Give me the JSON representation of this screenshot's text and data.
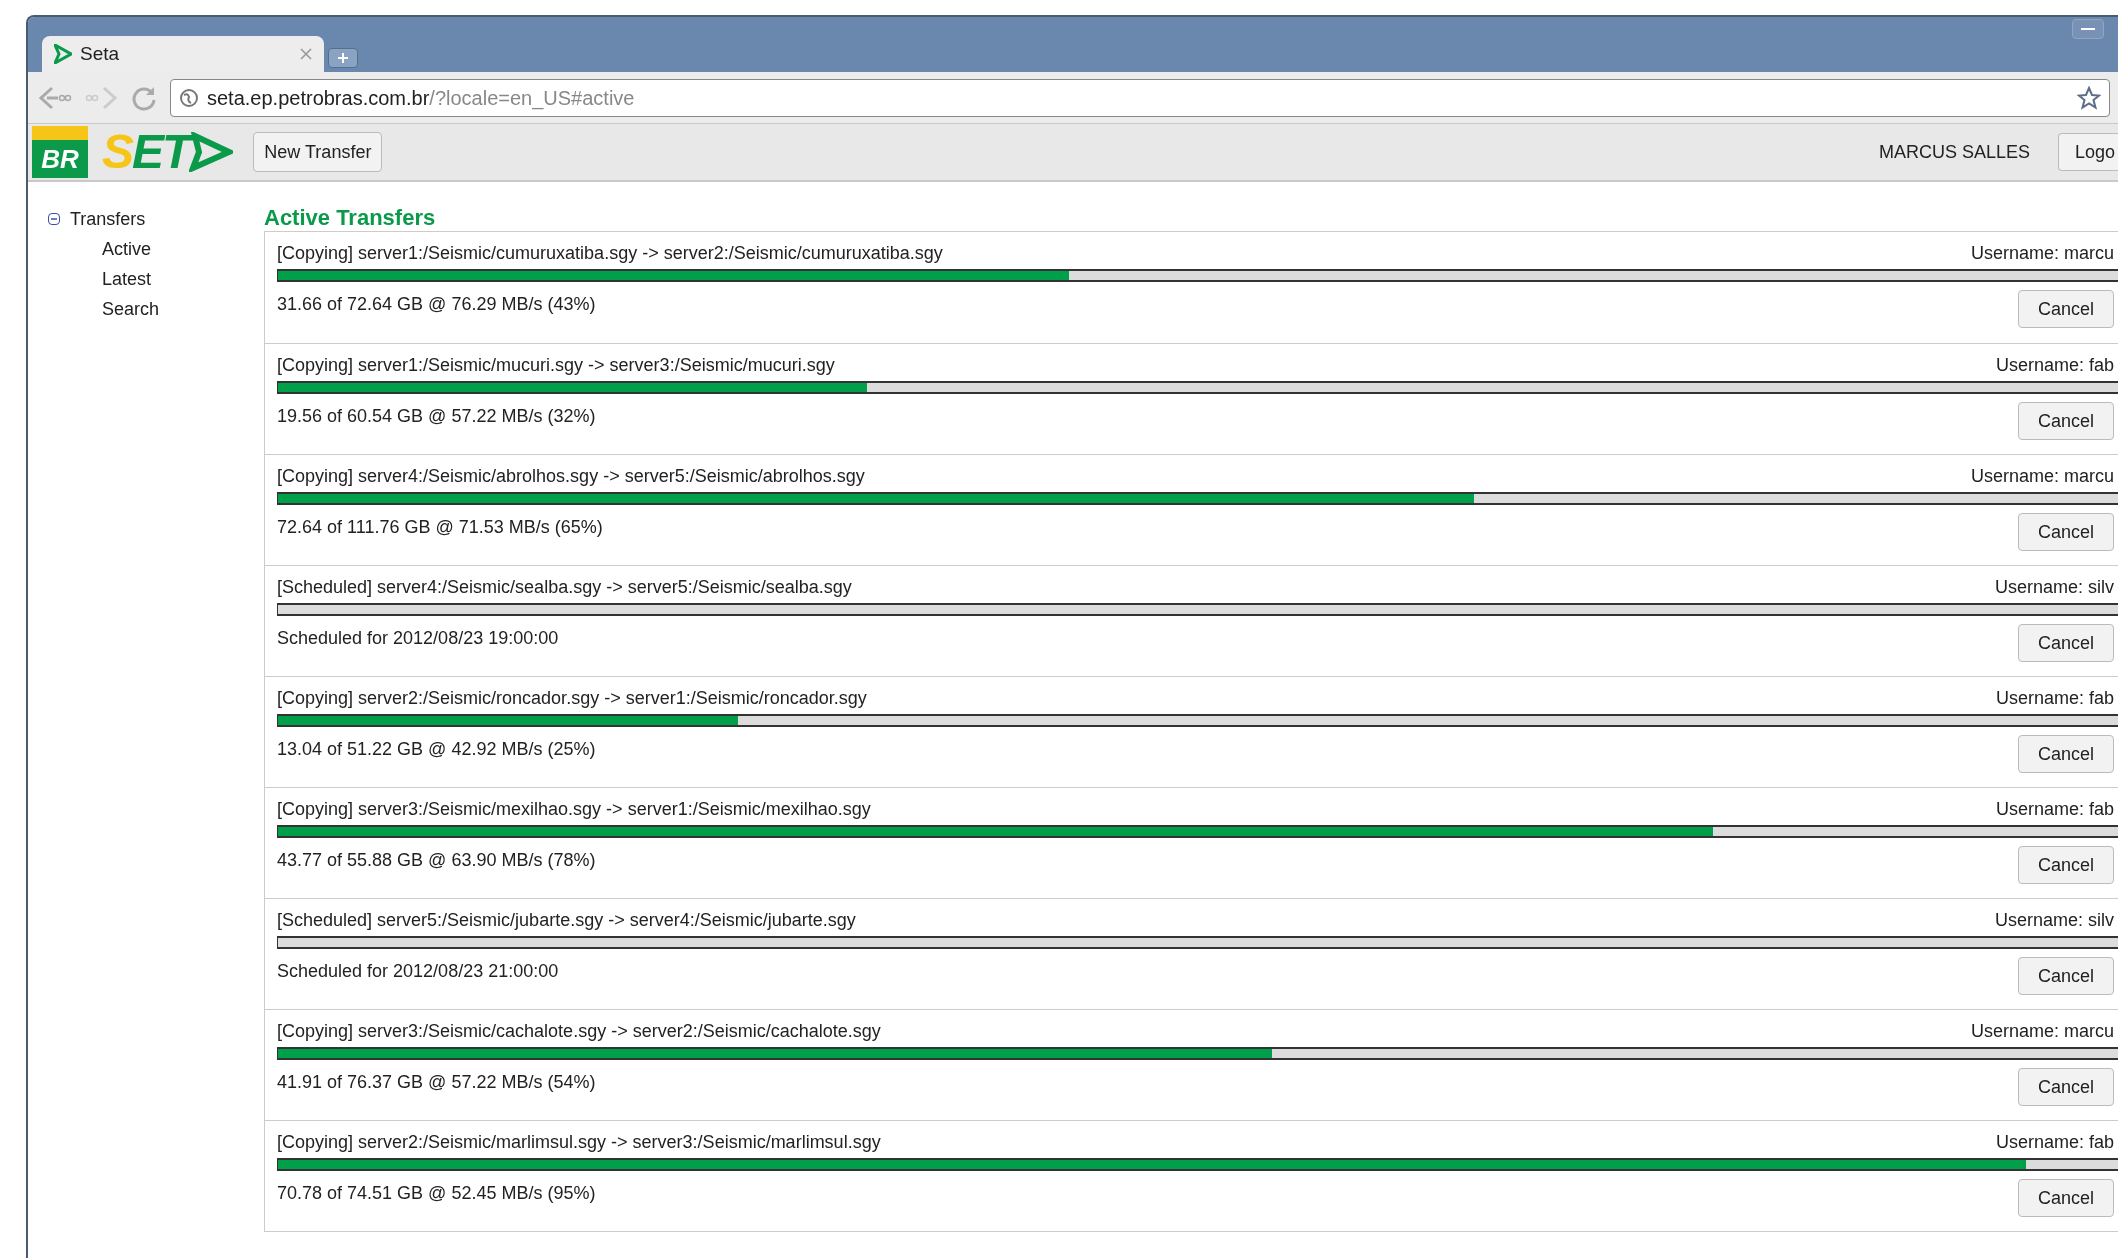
{
  "browser": {
    "tab_title": "Seta",
    "url_host": "seta.ep.petrobras.com.br",
    "url_rest": "/?locale=en_US#active"
  },
  "header": {
    "logo_badge": "BR",
    "logo_text": "SET",
    "new_transfer": "New Transfer",
    "user": "MARCUS SALLES",
    "logout": "Logo"
  },
  "sidebar": {
    "root": {
      "label": "Transfers",
      "expanded": true,
      "children": [
        {
          "label": "Active"
        },
        {
          "label": "Latest"
        },
        {
          "label": "Search"
        }
      ]
    }
  },
  "heading": "Active Transfers",
  "transfers": [
    {
      "title": "[Copying] server1:/Seismic/cumuruxatiba.sgy -> server2:/Seismic/cumuruxatiba.sgy",
      "username": "Username: marcu",
      "level": 0.43,
      "detail": "31.66 of 72.64 GB @ 76.29 MB/s (43%)",
      "cancel": "Cancel"
    },
    {
      "title": "[Copying] server1:/Seismic/mucuri.sgy -> server3:/Seismic/mucuri.sgy",
      "username": "Username: fab",
      "level": 0.32,
      "detail": "19.56 of 60.54 GB @ 57.22 MB/s (32%)",
      "cancel": "Cancel"
    },
    {
      "title": "[Copying] server4:/Seismic/abrolhos.sgy -> server5:/Seismic/abrolhos.sgy",
      "username": "Username: marcu",
      "level": 0.65,
      "detail": "72.64 of 111.76 GB @ 71.53 MB/s (65%)",
      "cancel": "Cancel"
    },
    {
      "title": "[Scheduled] server4:/Seismic/sealba.sgy -> server5:/Seismic/sealba.sgy",
      "username": "Username: silv",
      "level": 0,
      "detail": "Scheduled for 2012/08/23 19:00:00",
      "cancel": "Cancel"
    },
    {
      "title": "[Copying] server2:/Seismic/roncador.sgy -> server1:/Seismic/roncador.sgy",
      "username": "Username: fab",
      "level": 0.25,
      "detail": "13.04 of 51.22 GB @ 42.92 MB/s (25%)",
      "cancel": "Cancel"
    },
    {
      "title": "[Copying] server3:/Seismic/mexilhao.sgy -> server1:/Seismic/mexilhao.sgy",
      "username": "Username: fab",
      "level": 0.78,
      "detail": "43.77 of 55.88 GB @ 63.90 MB/s (78%)",
      "cancel": "Cancel"
    },
    {
      "title": "[Scheduled] server5:/Seismic/jubarte.sgy -> server4:/Seismic/jubarte.sgy",
      "username": "Username: silv",
      "level": 0,
      "detail": "Scheduled for 2012/08/23 21:00:00",
      "cancel": "Cancel"
    },
    {
      "title": "[Copying] server3:/Seismic/cachalote.sgy -> server2:/Seismic/cachalote.sgy",
      "username": "Username: marcu",
      "level": 0.54,
      "detail": "41.91 of 76.37 GB @ 57.22 MB/s (54%)",
      "cancel": "Cancel"
    },
    {
      "title": "[Copying] server2:/Seismic/marlimsul.sgy -> server3:/Seismic/marlimsul.sgy",
      "username": "Username: fab",
      "level": 0.95,
      "detail": "70.78 of 74.51 GB @ 52.45 MB/s (95%)",
      "cancel": "Cancel"
    }
  ]
}
